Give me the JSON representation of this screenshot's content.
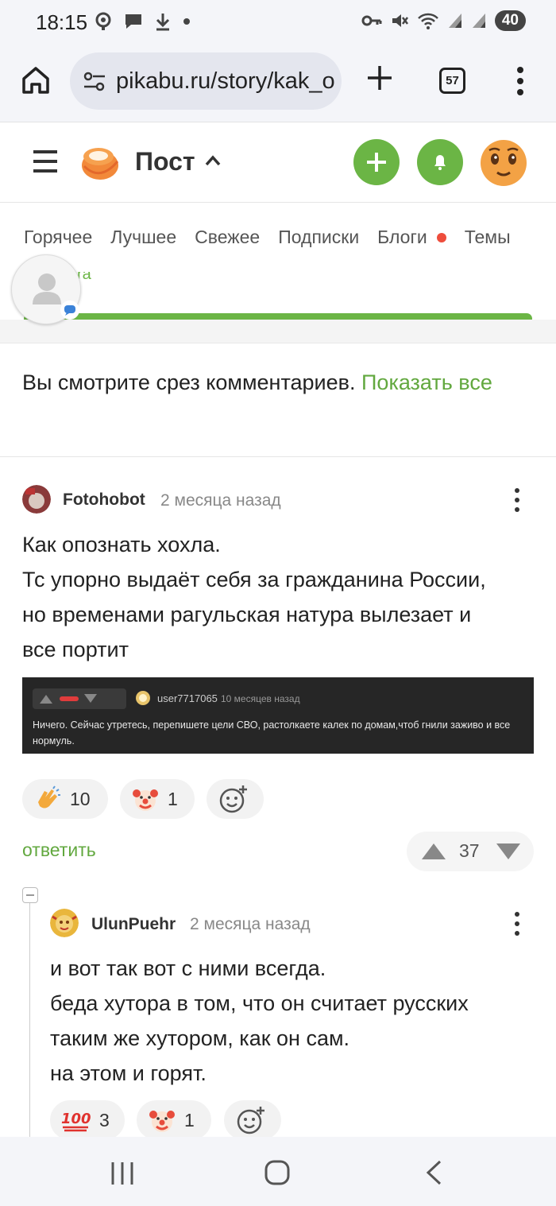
{
  "status": {
    "time": "18:15",
    "battery": "40"
  },
  "browser": {
    "url": "pikabu.ru/story/kak_o",
    "tab_count": "57"
  },
  "header": {
    "title": "Пост"
  },
  "nav": {
    "items": [
      {
        "label": "Горячее"
      },
      {
        "label": "Лучшее"
      },
      {
        "label": "Свежее"
      },
      {
        "label": "Подписки"
      },
      {
        "label": "Блоги"
      },
      {
        "label": "Темы"
      }
    ]
  },
  "partial_card": {
    "text": "ra"
  },
  "notice": {
    "text": "Вы смотрите срез комментариев.",
    "link": "Показать все"
  },
  "comment1": {
    "author": "Fotohobot",
    "time": "2 месяца назад",
    "lines": [
      "Как опознать хохла.",
      "Тс упорно выдаёт себя за гражданина России,",
      "но временами рагульская натура вылезает и",
      "все портит"
    ],
    "screenshot": {
      "user": "user7717065",
      "time": "10 месяцев назад",
      "text": "Ничего. Сейчас утретесь, перепишете цели СВО, растолкаете калек по домам,чтоб гнили заживо и все нормуль."
    },
    "reactions": {
      "clap": "10",
      "clown": "1"
    },
    "reply": "ответить",
    "rating": "37"
  },
  "comment2": {
    "author": "UlunPuehr",
    "time": "2 месяца назад",
    "lines": [
      "и вот так вот с ними всегда.",
      "беда хутора в том, что он считает русских",
      "таким же хутором, как он сам.",
      "на этом и горят."
    ],
    "reactions": {
      "hundred": "3",
      "clown": "1"
    }
  },
  "colors": {
    "accent_green": "#6bb545",
    "link_green": "#62a83f",
    "dot_red": "#ee4d3c"
  }
}
